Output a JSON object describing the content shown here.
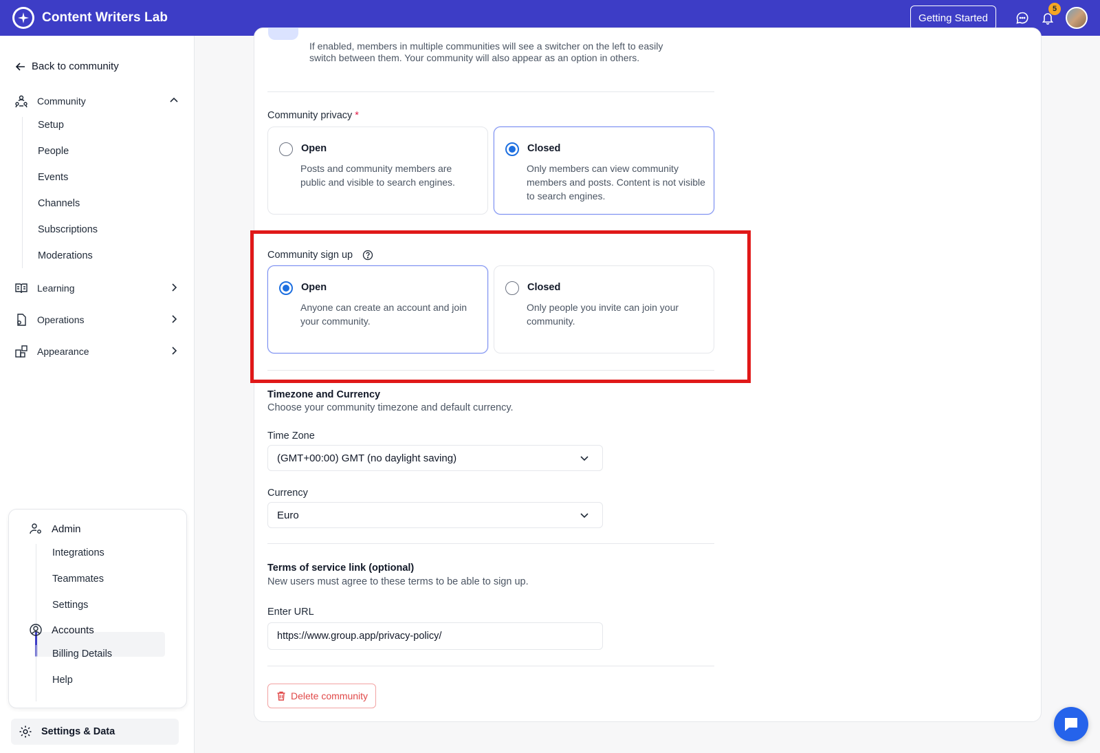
{
  "app": {
    "title": "Content Writers Lab"
  },
  "header": {
    "getting_started": "Getting Started",
    "notification_count": "5"
  },
  "sidebar": {
    "back": "Back to community",
    "community": {
      "label": "Community",
      "items": [
        "Setup",
        "People",
        "Events",
        "Channels",
        "Subscriptions",
        "Moderations"
      ]
    },
    "learning": "Learning",
    "operations": "Operations",
    "appearance": "Appearance",
    "admin": {
      "label": "Admin",
      "items": [
        "Integrations",
        "Teammates",
        "Settings"
      ]
    },
    "accounts": {
      "label": "Accounts",
      "items": [
        "Billing Details",
        "Help"
      ]
    },
    "settings_data": "Settings & Data"
  },
  "main": {
    "switcher_description": "If enabled, members in multiple communities will see a switcher on the left to easily switch between them. Your community will also appear as an option in others.",
    "privacy": {
      "label": "Community privacy",
      "required_mark": "*",
      "open": {
        "title": "Open",
        "desc": "Posts and community members are public and visible to search engines.",
        "selected": false
      },
      "closed": {
        "title": "Closed",
        "desc": "Only members can view community members and posts. Content is not visible to search engines.",
        "selected": true
      }
    },
    "signup": {
      "label": "Community sign up",
      "open": {
        "title": "Open",
        "desc": "Anyone can create an account and join your community.",
        "selected": true
      },
      "closed": {
        "title": "Closed",
        "desc": "Only people you invite can join your community.",
        "selected": false
      }
    },
    "tz_currency": {
      "title": "Timezone and Currency",
      "subtitle": "Choose your community timezone and default currency.",
      "timezone_label": "Time Zone",
      "timezone_value": "(GMT+00:00) GMT (no daylight saving)",
      "currency_label": "Currency",
      "currency_value": "Euro"
    },
    "terms": {
      "title": "Terms of service link (optional)",
      "subtitle": "New users must agree to these terms to be able to sign up.",
      "url_label": "Enter URL",
      "url_value": "https://www.group.app/privacy-policy/"
    },
    "delete_label": "Delete community"
  },
  "colors": {
    "brand": "#3d3dc6",
    "radio_selected": "#1d6fe0",
    "highlight": "#e01818",
    "danger": "#e04848"
  }
}
